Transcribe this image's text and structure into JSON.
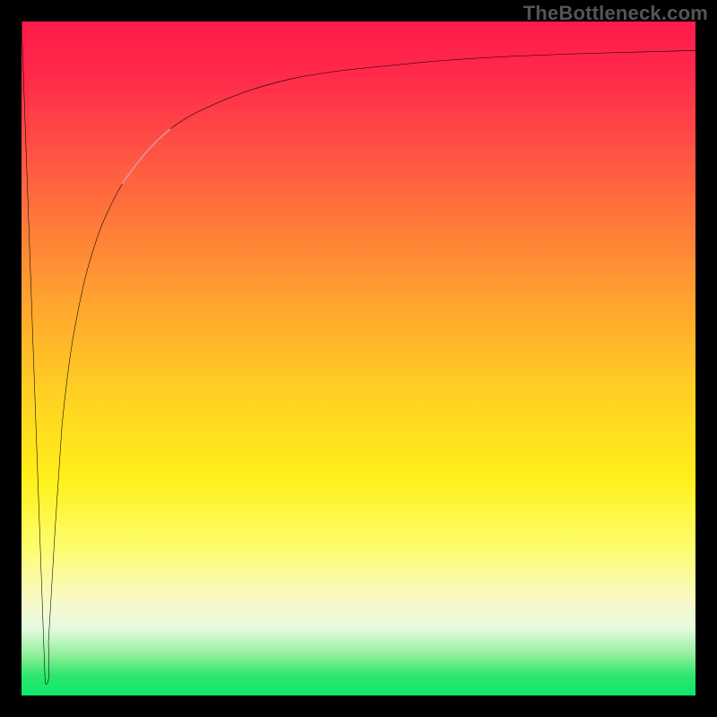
{
  "attribution": "TheBottleneck.com",
  "chart_data": {
    "type": "line",
    "title": "",
    "xlabel": "",
    "ylabel": "",
    "xlim": [
      0,
      100
    ],
    "ylim": [
      0,
      100
    ],
    "grid": false,
    "legend": false,
    "background_gradient": {
      "direction": "vertical",
      "stops": [
        {
          "pos": 0.0,
          "color": "#ff1a4b"
        },
        {
          "pos": 0.3,
          "color": "#ff7a3a"
        },
        {
          "pos": 0.55,
          "color": "#ffd023"
        },
        {
          "pos": 0.78,
          "color": "#fdfd6e"
        },
        {
          "pos": 0.9,
          "color": "#e6fbe0"
        },
        {
          "pos": 1.0,
          "color": "#0ce86a"
        }
      ]
    },
    "series": [
      {
        "name": "left-falling-edge",
        "x": [
          0.0,
          3.5
        ],
        "y": [
          100,
          2
        ],
        "color": "#000000"
      },
      {
        "name": "main-curve",
        "x": [
          3.5,
          4,
          5,
          6,
          8,
          10,
          12,
          15,
          18,
          22,
          27,
          33,
          40,
          50,
          60,
          72,
          85,
          100
        ],
        "y": [
          2,
          8,
          25,
          40,
          55,
          64,
          70,
          76,
          80,
          84,
          87,
          89.5,
          91.5,
          93,
          94,
          94.8,
          95.3,
          95.7
        ],
        "color": "#000000"
      },
      {
        "name": "highlight-segment",
        "x": [
          15,
          22
        ],
        "y": [
          76,
          84
        ],
        "color": "#d89a9a",
        "stroke_width": 10
      }
    ],
    "annotations": []
  }
}
